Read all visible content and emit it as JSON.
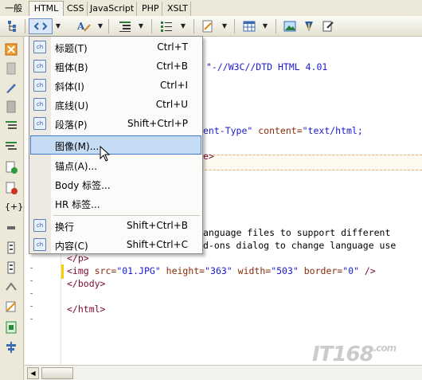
{
  "tabs": [
    "一般",
    "HTML",
    "CSS",
    "JavaScript",
    "PHP",
    "XSLT"
  ],
  "active_tab": "HTML",
  "toolbar_icons": [
    "tree-icon",
    "code-tag-icon",
    "font-icon",
    "indent-icon",
    "list-icon",
    "edit-doc-icon",
    "table-icon",
    "image-icon",
    "pen-icon",
    "note-icon"
  ],
  "left_icons": [
    "close-icon",
    "block-icon",
    "pen-icon",
    "page-icon",
    "indent-icon",
    "outdent-icon",
    "add-doc-icon",
    "remove-doc-icon",
    "brace-icon",
    "bar-icon",
    "format-icon",
    "format-icon",
    "wrap-icon",
    "edit-icon",
    "page-green-icon",
    "align-icon"
  ],
  "menu": {
    "items": [
      {
        "label": "标题(T)",
        "shortcut": "Ctrl+T",
        "icon": "ch-icon"
      },
      {
        "label": "粗体(B)",
        "shortcut": "Ctrl+B",
        "icon": "ch-icon"
      },
      {
        "label": "斜体(I)",
        "shortcut": "Ctrl+I",
        "icon": "ch-icon"
      },
      {
        "label": "底线(U)",
        "shortcut": "Ctrl+U",
        "icon": "ch-icon"
      },
      {
        "label": "段落(P)",
        "shortcut": "Shift+Ctrl+P",
        "icon": "ch-icon"
      },
      {
        "label": "图像(M)...",
        "shortcut": "",
        "icon": "",
        "selected": true
      },
      {
        "label": "锚点(A)...",
        "shortcut": "",
        "icon": ""
      },
      {
        "label": "Body 标签...",
        "shortcut": "",
        "icon": ""
      },
      {
        "label": "HR 标签...",
        "shortcut": "",
        "icon": ""
      },
      {
        "label": "换行",
        "shortcut": "Shift+Ctrl+B",
        "icon": "ch-icon"
      },
      {
        "label": "内容(C)",
        "shortcut": "Shift+Ctrl+C",
        "icon": "ch-icon"
      }
    ]
  },
  "code": {
    "line1": "\"-//W3C//DTD HTML 4.01",
    "line2_pre": "ent-Type\"",
    "line2_attr": " content=",
    "line2_val": "\"text/html;",
    "line3": "e>",
    "line4": "anguage files to support different",
    "line5": "d-ons dialog to change language use",
    "line6": "</p>",
    "img_tag": "<img ",
    "img_src_attr": "src=",
    "img_src_val": "\"01.JPG\"",
    "img_h_attr": " height=",
    "img_h_val": "\"363\"",
    "img_w_attr": " width=",
    "img_w_val": "\"503\"",
    "img_b_attr": " border=",
    "img_b_val": "\"0\"",
    "img_end": " />",
    "body_close": "</body>",
    "html_close": "</html>"
  },
  "watermark": {
    "text": "IT168",
    "suffix": ".com"
  }
}
